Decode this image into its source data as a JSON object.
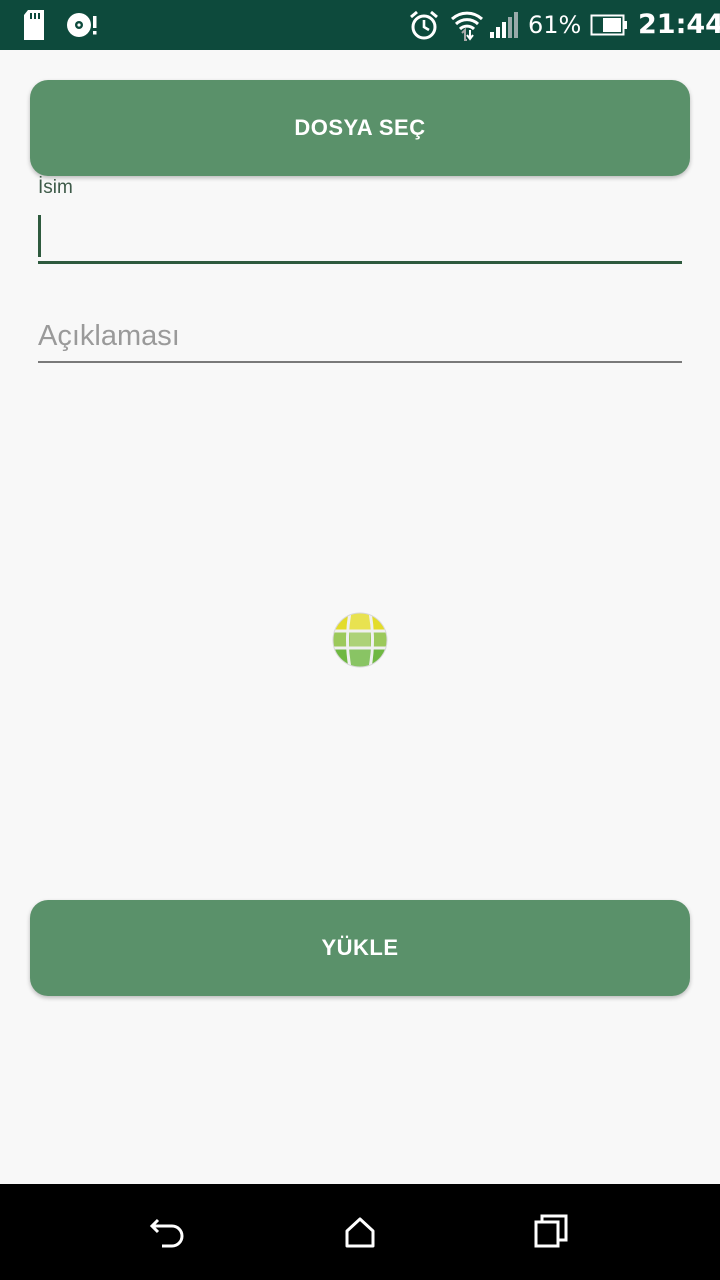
{
  "status_bar": {
    "icons": [
      "sd-card-icon",
      "disc-alert-icon",
      "alarm-icon",
      "wifi-icon",
      "signal-icon",
      "battery-icon"
    ],
    "battery_percent": "61%",
    "time": "21:44"
  },
  "form": {
    "choose_file_label": "DOSYA SEÇ",
    "name_label": "İsim",
    "name_value": "",
    "description_placeholder": "Açıklaması",
    "upload_label": "YÜKLE"
  },
  "nav_bar": {
    "icons": [
      "back-icon",
      "home-icon",
      "recents-icon"
    ]
  },
  "colors": {
    "status_bar": "#0d4a3c",
    "button": "#5a916a",
    "accent": "#2e5a3e",
    "background": "#f8f8f8"
  }
}
